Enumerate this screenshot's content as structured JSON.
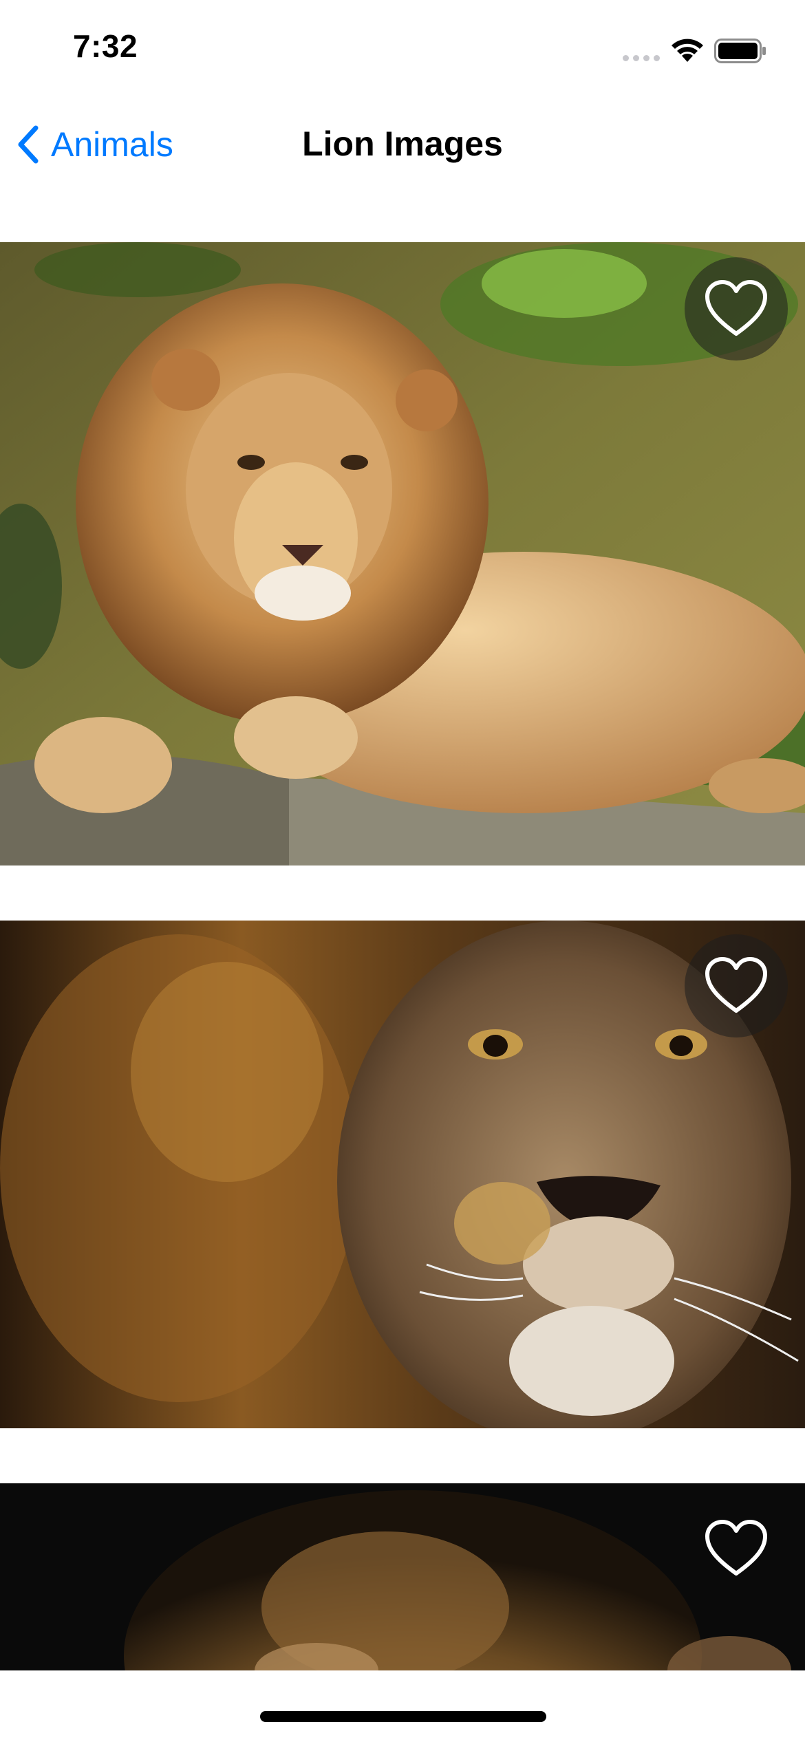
{
  "status_bar": {
    "time": "7:32"
  },
  "nav": {
    "back_label": "Animals",
    "title": "Lion Images",
    "accent_color": "#007aff"
  },
  "cards": [
    {
      "favorite_icon": "heart-outline-icon",
      "favorited": false
    },
    {
      "favorite_icon": "heart-outline-icon",
      "favorited": false
    },
    {
      "favorite_icon": "heart-outline-icon",
      "favorited": false
    }
  ]
}
